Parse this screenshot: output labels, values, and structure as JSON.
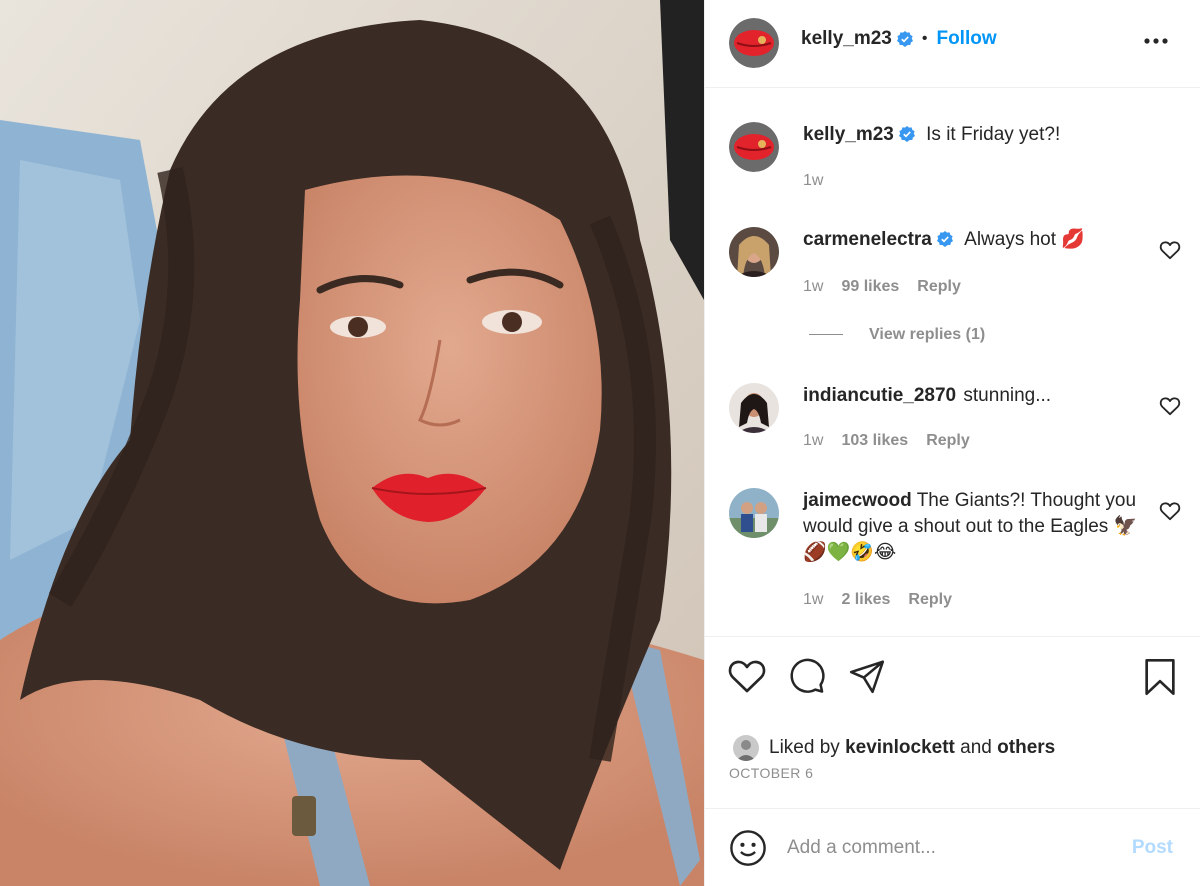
{
  "post": {
    "author": "kelly_m23",
    "follow_label": "Follow",
    "dot": "•",
    "caption": "Is it Friday yet?!",
    "caption_time": "1w"
  },
  "comments": [
    {
      "user": "carmenelectra",
      "verified": true,
      "text": "Always hot 💋",
      "time": "1w",
      "likes": "99 likes",
      "reply": "Reply",
      "view_replies": "View replies (1)"
    },
    {
      "user": "indiancutie_2870",
      "verified": false,
      "text": "stunning...",
      "time": "1w",
      "likes": "103 likes",
      "reply": "Reply"
    },
    {
      "user": "jaimecwood",
      "verified": false,
      "text": "The Giants?! Thought you would give a shout out to the Eagles 🦅🏈💚🤣😂",
      "time": "1w",
      "likes": "2 likes",
      "reply": "Reply"
    }
  ],
  "likes_bar": {
    "prefix": "Liked by",
    "user": "kevinlockett",
    "and": "and",
    "others": "others",
    "date": "OCTOBER 6"
  },
  "add_comment": {
    "placeholder": "Add a comment...",
    "post_label": "Post"
  },
  "icons": {
    "more": "more-horizontal-icon",
    "heart": "heart-icon",
    "comment": "comment-icon",
    "share": "paper-plane-icon",
    "save": "bookmark-icon",
    "emoji": "smiley-icon",
    "verified": "verified-badge-icon"
  },
  "colors": {
    "accent": "#0095f6",
    "post_disabled": "#b3dbff",
    "muted": "#8e8e8e",
    "text": "#262626"
  }
}
